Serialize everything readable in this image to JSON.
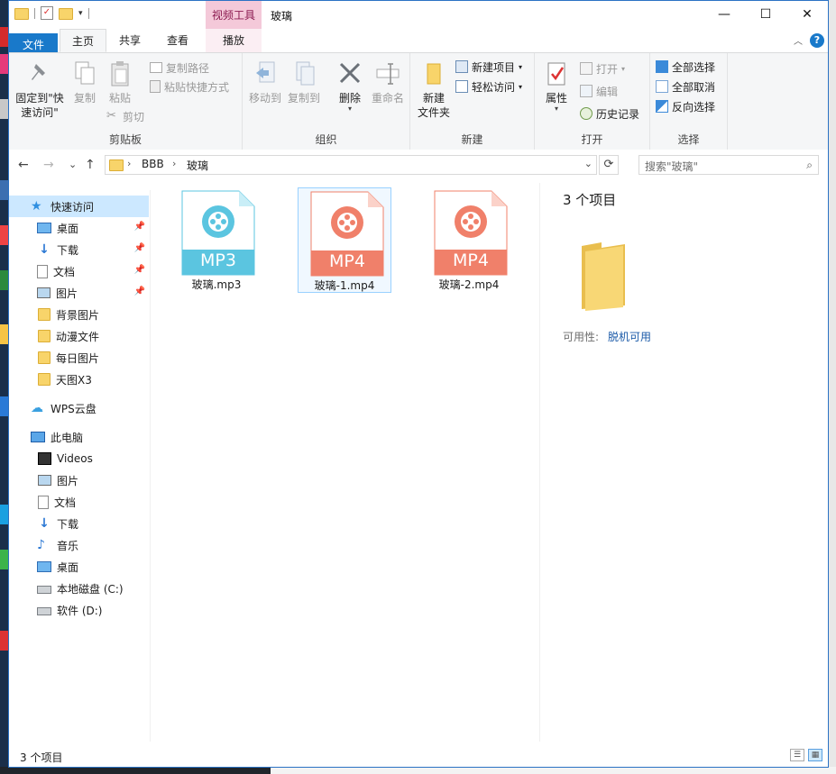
{
  "window": {
    "title": "玻璃",
    "context_tab": "视频工具",
    "controls": {
      "minimize": "—",
      "maximize": "☐",
      "close": "✕"
    }
  },
  "qat": {
    "dropdown": "▾"
  },
  "tabs": {
    "file": "文件",
    "home": "主页",
    "share": "共享",
    "view": "查看",
    "play": "播放",
    "collapse": "︿",
    "help": "?"
  },
  "ribbon": {
    "clipboard": {
      "label": "剪贴板",
      "pin": "固定到\"快",
      "pin2": "速访问\"",
      "copy": "复制",
      "paste": "粘贴",
      "copy_path": "复制路径",
      "paste_shortcut": "粘贴快捷方式",
      "cut": "剪切"
    },
    "organize": {
      "label": "组织",
      "move_to": "移动到",
      "copy_to": "复制到",
      "delete": "删除",
      "rename": "重命名"
    },
    "new": {
      "label": "新建",
      "new_folder": "新建",
      "new_folder2": "文件夹",
      "new_item": "新建项目",
      "easy_access": "轻松访问"
    },
    "open": {
      "label": "打开",
      "properties": "属性",
      "open": "打开",
      "edit": "编辑",
      "history": "历史记录"
    },
    "select": {
      "label": "选择",
      "select_all": "全部选择",
      "select_none": "全部取消",
      "invert": "反向选择"
    }
  },
  "nav": {
    "back": "←",
    "forward": "→",
    "recent": "⌄",
    "up": "↑",
    "breadcrumb": [
      "BBB",
      "玻璃"
    ],
    "crumb_sep": "›",
    "address_dropdown": "⌄",
    "refresh": "⟳",
    "search_placeholder": "搜索\"玻璃\"",
    "search_icon": "⌕"
  },
  "sidebar": {
    "pin": "📌",
    "items": [
      {
        "label": "快速访问"
      },
      {
        "label": "桌面"
      },
      {
        "label": "下载"
      },
      {
        "label": "文档"
      },
      {
        "label": "图片"
      },
      {
        "label": "背景图片"
      },
      {
        "label": "动漫文件"
      },
      {
        "label": "每日图片"
      },
      {
        "label": "天图X3"
      },
      {
        "label": "WPS云盘"
      },
      {
        "label": "此电脑"
      },
      {
        "label": "Videos"
      },
      {
        "label": "图片"
      },
      {
        "label": "文档"
      },
      {
        "label": "下载"
      },
      {
        "label": "音乐"
      },
      {
        "label": "桌面"
      },
      {
        "label": "本地磁盘 (C:)"
      },
      {
        "label": "软件 (D:)"
      }
    ]
  },
  "files": [
    {
      "name": "玻璃.mp3",
      "badge": "MP3",
      "color": "#5bc5e0",
      "fold": "#c9eef7"
    },
    {
      "name": "玻璃-1.mp4",
      "badge": "MP4",
      "color": "#f0806a",
      "fold": "#fbd2c9"
    },
    {
      "name": "玻璃-2.mp4",
      "badge": "MP4",
      "color": "#f0806a",
      "fold": "#fbd2c9"
    }
  ],
  "details": {
    "count": "3 个项目",
    "availability_label": "可用性:",
    "availability_value": "脱机可用"
  },
  "status": {
    "count": "3 个项目",
    "details_view": "☰",
    "tiles_view": "▦"
  }
}
